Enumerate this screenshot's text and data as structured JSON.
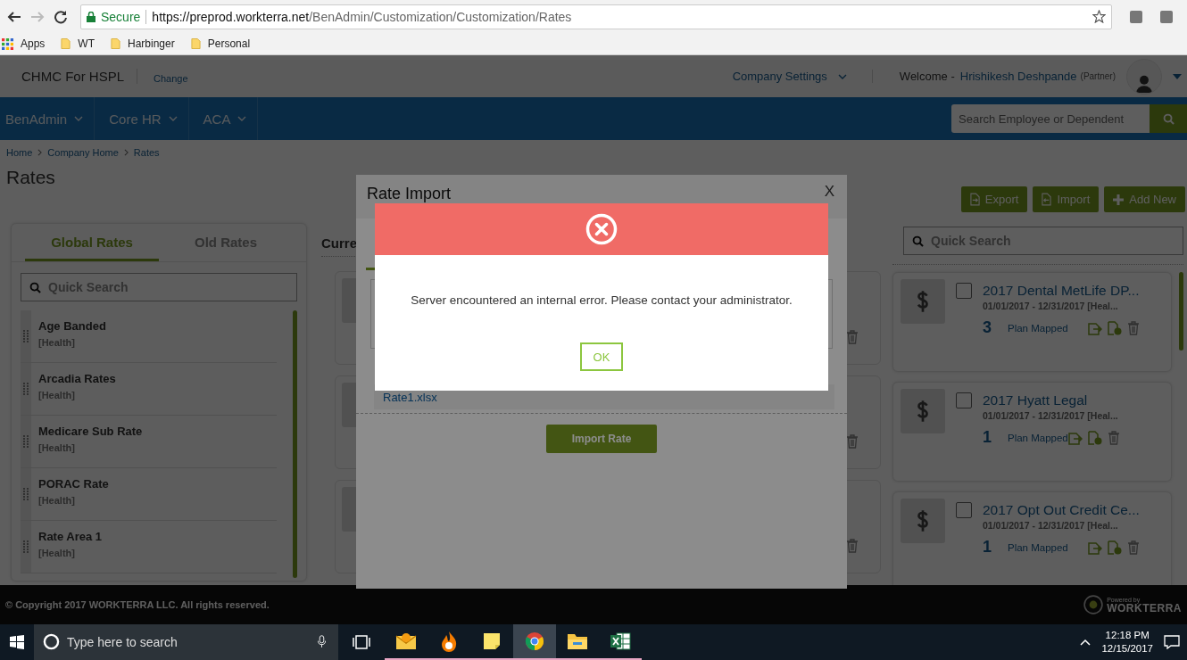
{
  "browser": {
    "secure_label": "Secure",
    "url_host": "https://preprod.workterra.net",
    "url_path": "/BenAdmin/Customization/Customization/Rates",
    "bookmarks": [
      {
        "kind": "apps",
        "label": "Apps"
      },
      {
        "kind": "folder",
        "label": "WT"
      },
      {
        "kind": "folder",
        "label": "Harbinger"
      },
      {
        "kind": "folder",
        "label": "Personal"
      }
    ]
  },
  "header": {
    "company": "CHMC For HSPL",
    "change_link": "Change",
    "settings": "Company Settings",
    "welcome": "Welcome -",
    "user": "Hrishikesh Deshpande",
    "role": "(Partner)"
  },
  "nav": {
    "items": [
      "BenAdmin",
      "Core HR",
      "ACA"
    ],
    "search_placeholder": "Search Employee or Dependent"
  },
  "breadcrumbs": [
    "Home",
    "Company Home",
    "Rates"
  ],
  "page_title": "Rates",
  "left_panel": {
    "tabs": [
      {
        "label": "Global Rates",
        "selected": true
      },
      {
        "label": "Old Rates",
        "selected": false
      }
    ],
    "search_placeholder": "Quick Search",
    "items": [
      {
        "name": "Age Banded",
        "category": "[Health]"
      },
      {
        "name": "Arcadia Rates",
        "category": "[Health]"
      },
      {
        "name": "Medicare Sub Rate",
        "category": "[Health]"
      },
      {
        "name": "PORAC Rate",
        "category": "[Health]"
      },
      {
        "name": "Rate Area 1",
        "category": "[Health]"
      }
    ]
  },
  "middle": {
    "heading": "Curre"
  },
  "toolbar": [
    {
      "kind": "export",
      "label": "Export"
    },
    {
      "kind": "import",
      "label": "Import"
    },
    {
      "kind": "add",
      "label": "Add New"
    }
  ],
  "right_search_placeholder": "Quick Search",
  "rate_cards": [
    {
      "title": "2017 Dental MetLife DP...",
      "dates": "01/01/2017 - 12/31/2017 [Heal...",
      "count": "3",
      "count_label": "Plan Mapped",
      "checked": false
    },
    {
      "title": "2017 Hyatt Legal",
      "dates": "01/01/2017 - 12/31/2017 [Heal...",
      "count": "1",
      "count_label": "Plan Mapped",
      "checked": false
    },
    {
      "title": "2017 Opt Out Credit Ce...",
      "dates": "01/01/2017 - 12/31/2017 [Heal...",
      "count": "1",
      "count_label": "Plan Mapped",
      "checked": false
    }
  ],
  "footer": {
    "copyright": "© Copyright 2017 WORKTERRA LLC. All rights reserved.",
    "powered_by": "Powered by",
    "brand": "WORKTERRA"
  },
  "import_modal": {
    "title": "Rate Import",
    "close": "X",
    "file_name": "Rate1.xlsx",
    "button": "Import Rate"
  },
  "error_dialog": {
    "message": "Server encountered an internal error. Please contact your administrator.",
    "button": "OK"
  },
  "taskbar": {
    "search_placeholder": "Type here to search",
    "apps": [
      {
        "kind": "mail",
        "selected": false
      },
      {
        "kind": "flame",
        "selected": false
      },
      {
        "kind": "note",
        "selected": false
      },
      {
        "kind": "chrome",
        "selected": true
      },
      {
        "kind": "folder",
        "selected": false
      },
      {
        "kind": "sheet",
        "selected": false
      }
    ],
    "time": "12:18 PM",
    "date": "12/15/2017"
  }
}
